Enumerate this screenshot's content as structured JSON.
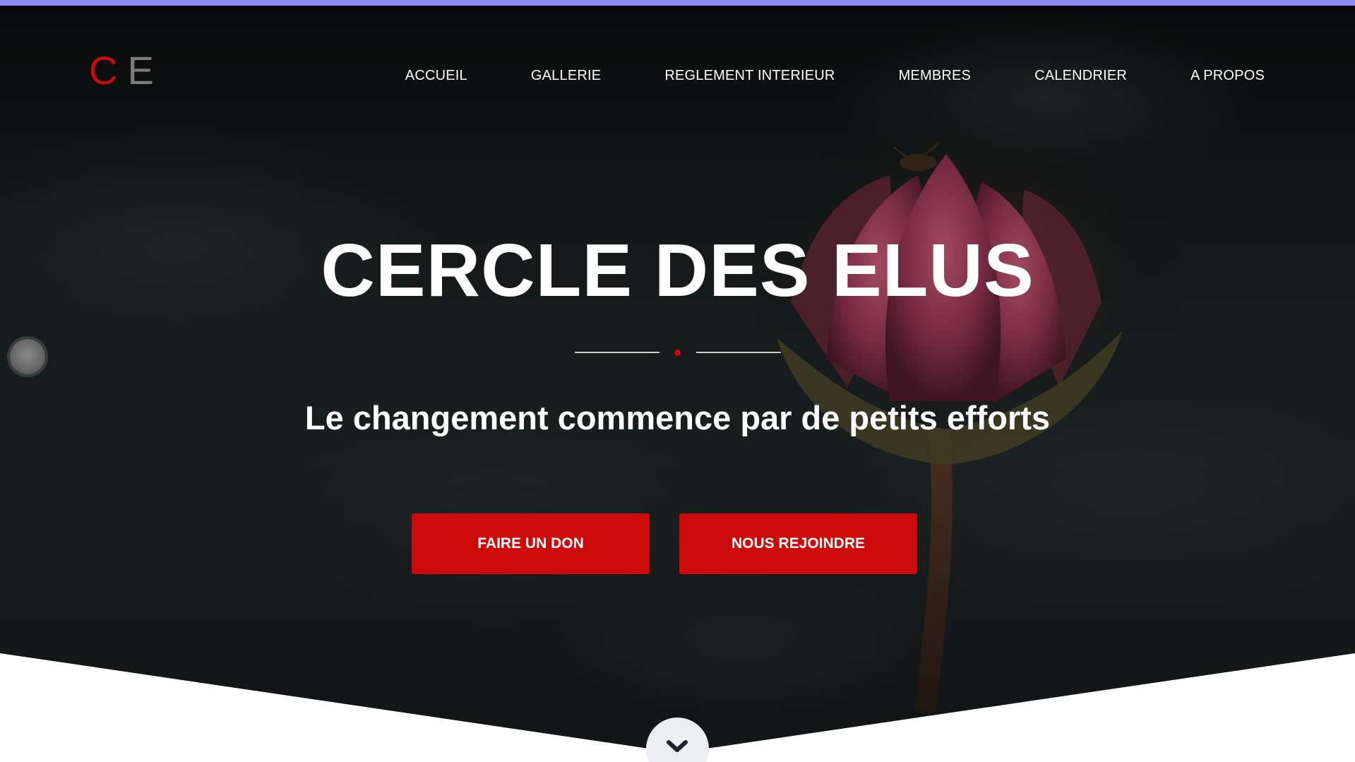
{
  "logo": {
    "letter_1": "C",
    "letter_2": "E"
  },
  "nav": {
    "items": [
      {
        "label": "ACCUEIL"
      },
      {
        "label": "GALLERIE"
      },
      {
        "label": "REGLEMENT INTERIEUR"
      },
      {
        "label": "MEMBRES"
      },
      {
        "label": "CALENDRIER"
      },
      {
        "label": "A PROPOS"
      }
    ]
  },
  "hero": {
    "title": "CERCLE DES ELUS",
    "subtitle": "Le changement commence par de petits efforts",
    "buttons": {
      "donate_label": "FAIRE UN DON",
      "join_label": "NOUS REJOINDRE"
    }
  },
  "colors": {
    "accent_red": "#cc0a0a",
    "top_bar": "#8c8cf2",
    "logo_grey": "#7d7d7d"
  },
  "icons": {
    "scroll": "chevron-down-icon",
    "side_handle": "circle-handle-icon"
  }
}
